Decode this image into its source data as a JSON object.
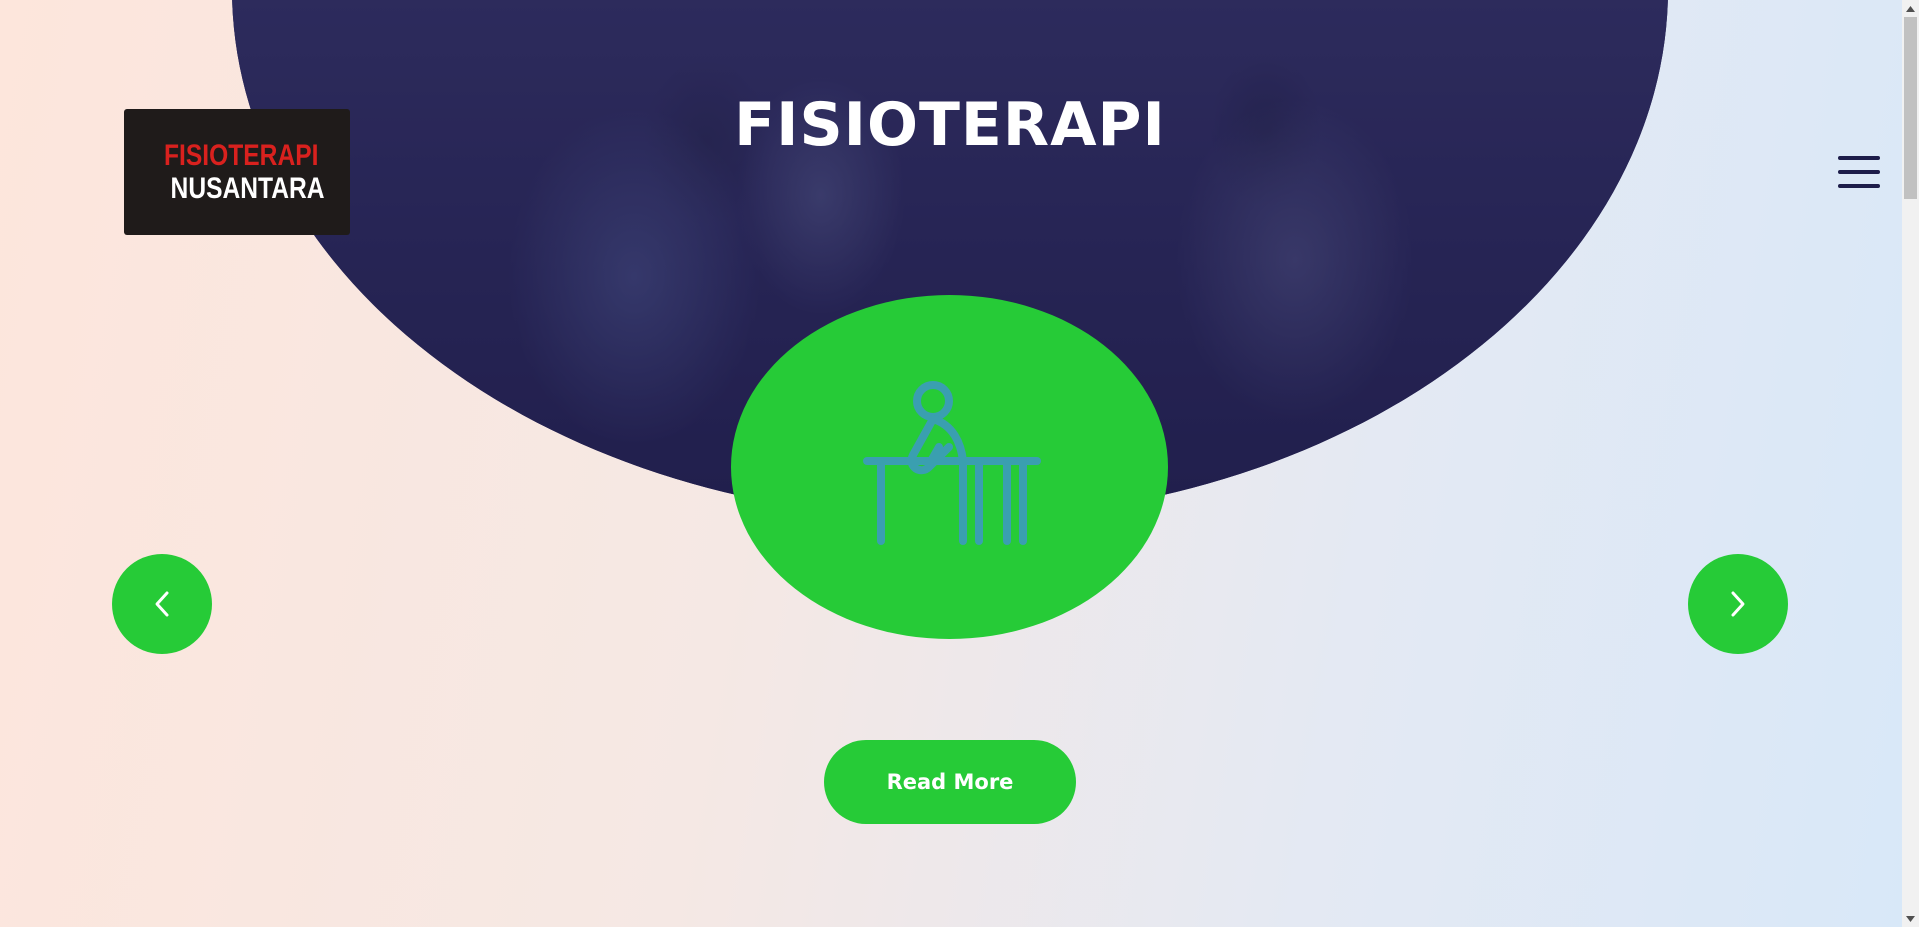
{
  "brand": {
    "logo_line1": "FISIOTERAPI",
    "logo_line2": "NUSANTARA",
    "logo_bg_color": "#1f1b1a",
    "logo_accent_color": "#d9211e"
  },
  "hero": {
    "title": "FISIOTERAPI",
    "overlay_color": "#2f2d5c"
  },
  "service": {
    "icon": "physiotherapy-patient-icon",
    "circle_color": "#26cb37",
    "icon_color": "#3a9fb0"
  },
  "carousel": {
    "prev_icon": "chevron-left-icon",
    "next_icon": "chevron-right-icon"
  },
  "cta": {
    "read_more_label": "Read More",
    "button_color": "#26cb37"
  },
  "header": {
    "menu_icon": "hamburger-menu-icon",
    "menu_color": "#1e1d4a"
  }
}
